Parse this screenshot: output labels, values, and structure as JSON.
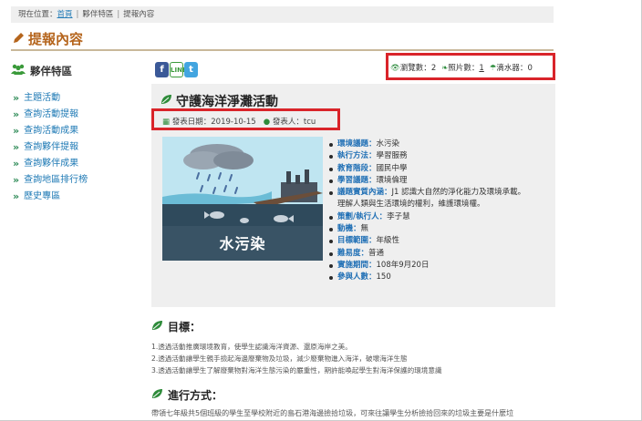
{
  "breadcrumb": {
    "prefix": "現在位置：",
    "home": "首頁",
    "sep1": "|",
    "section": "夥伴特區",
    "sep2": "|",
    "current": "提報內容"
  },
  "page_title": "提報內容",
  "sidebar": {
    "heading": "夥伴特區",
    "items": [
      {
        "label": "主題活動"
      },
      {
        "label": "查詢活動提報"
      },
      {
        "label": "查詢活動成果"
      },
      {
        "label": "查詢夥伴提報"
      },
      {
        "label": "查詢夥伴成果"
      },
      {
        "label": "查詢地區排行榜"
      },
      {
        "label": "歷史專區"
      }
    ]
  },
  "share": {
    "fb": "f",
    "line": "LINE",
    "twitter": "t"
  },
  "stats": {
    "views_label": "瀏覽數：",
    "views": "2",
    "photos_label": "照片數：",
    "photos": "1",
    "water_label": "滴水器：",
    "water": "0"
  },
  "activity": {
    "title": "守護海洋淨灘活動",
    "date_label": "發表日期：",
    "date": "2019-10-15",
    "author_label": "發表人：",
    "author": "tcu",
    "image_caption": "水污染"
  },
  "info": [
    {
      "key": "環境議題：",
      "value": "水污染"
    },
    {
      "key": "執行方法：",
      "value": "學習服務"
    },
    {
      "key": "教育階段：",
      "value": "國民中學"
    },
    {
      "key": "學習議題：",
      "value": "環境倫理"
    },
    {
      "key": "議題實質內涵：",
      "value": "J1 認識大自然的淨化能力及環境承載。",
      "cont": "理解人類與生活環境的權利，維護環境權。"
    },
    {
      "key": "策劃/執行人：",
      "value": "李子慧"
    },
    {
      "key": "動機：",
      "value": "無"
    },
    {
      "key": "目標範圍：",
      "value": "年級性"
    },
    {
      "key": "難易度：",
      "value": "普通"
    },
    {
      "key": "實施期間：",
      "value": "108年9月20日"
    },
    {
      "key": "參與人數：",
      "value": "150"
    }
  ],
  "goals": {
    "heading": "目標：",
    "items": [
      "1.透過活動推廣環境教育，使學生認識海洋資源、還原海岸之美。",
      "2.透過活動讓學生親手撿起海邊廢棄物及垃圾，減少廢棄物進入海洋，破壞海洋生態",
      "3.透過活動讓學生了解廢棄物對海洋生態污染的嚴重性，期許能喚起學生對海洋保護的環境意識"
    ]
  },
  "method": {
    "heading": "進行方式：",
    "text": "帶領七年級共5個班級的學生至學校附近的島石港海邊撿拾垃圾，可來往讓學生分析撿拾回來的垃圾主要是什麼垃"
  },
  "colors": {
    "accent": "#b5651d",
    "link": "#1f7ab5",
    "highlight": "#d9242a",
    "green": "#2e8b3a"
  }
}
